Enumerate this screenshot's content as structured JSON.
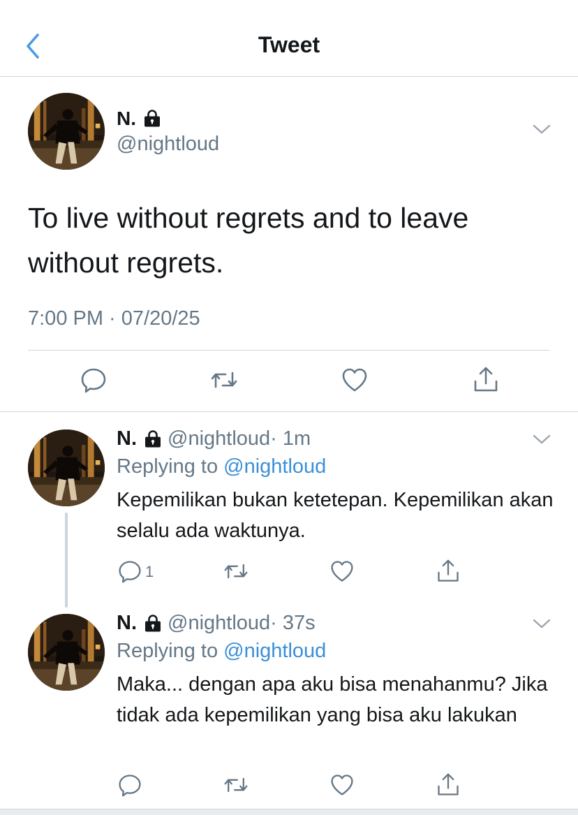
{
  "header": {
    "title": "Tweet",
    "back_icon": "chevron-left-icon"
  },
  "colors": {
    "link": "#3a8fd8",
    "secondary_text": "#657786",
    "divider": "#d3d6da",
    "back_icon": "#4a9ae6"
  },
  "main_tweet": {
    "name": "N.",
    "handle": "@nightloud",
    "text": "To live without regrets and to leave without regrets.",
    "timestamp": "7:00 PM · 07/20/25",
    "actions": [
      "reply-icon",
      "retweet-icon",
      "like-icon",
      "share-icon"
    ]
  },
  "replies": [
    {
      "name": "N.",
      "handle": "@nightloud",
      "time": " · 1m",
      "replying_prefix": "Replying to ",
      "replying_to": "@nightloud",
      "text": "Kepemilikan bukan ketetepan. Kepemilikan akan selalu ada waktunya.",
      "reply_count": "1"
    },
    {
      "name": "N.",
      "handle": "@nightloud",
      "time": " · 37s",
      "replying_prefix": "Replying to ",
      "replying_to": "@nightloud",
      "text": "Maka... dengan apa aku bisa menahanmu? Jika tidak ada kepemilikan yang bisa aku lakukan",
      "reply_count": ""
    }
  ]
}
